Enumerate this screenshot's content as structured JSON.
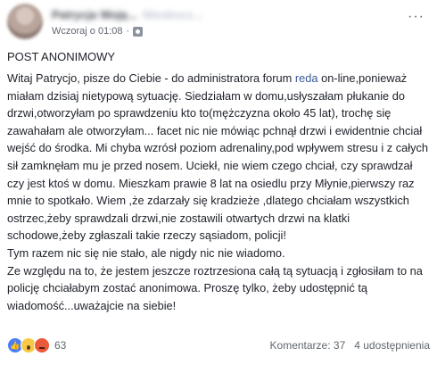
{
  "post": {
    "author_name": "Patrycja Woję...",
    "author_secondary": "Nieskocz...",
    "timestamp": "Wczoraj o 01:08",
    "privacy_icon": "public-globe-icon",
    "separator": "·",
    "more_label": "···",
    "title": "POST ANONIMOWY",
    "paragraph_1_before_link": "Witaj Patrycjo, pisze do Ciebie - do administratora forum ",
    "paragraph_1_link": "reda",
    "paragraph_1_after_link": " on-line,ponieważ miałam dzisiaj nietypową sytuację. Siedziałam w domu,usłyszałam płukanie do drzwi,otworzyłam po sprawdzeniu kto to(mężczyzna około 45 lat), trochę się zawahałam ale otworzyłam... facet nic nie mówiąc pchnął drzwi i ewidentnie chciał wejść do środka. Mi chyba wzrósł poziom adrenaliny,pod wpływem stresu i z całych sił zamknęłam mu je przed nosem. Uciekł, nie wiem czego chciał, czy sprawdzał czy jest ktoś w domu. Mieszkam prawie 8 lat na osiedlu przy Młynie,pierwszy raz mnie to spotkało. Wiem ,że zdarzały się kradzieże ,dlatego chciałam wszystkich ostrzec,żeby sprawdzali drzwi,nie zostawili otwartych drzwi na klatki schodowe,żeby zgłaszali takie rzeczy sąsiadom, policji!",
    "paragraph_2": "Tym razem nic się nie stało, ale nigdy nic nie wiadomo.",
    "paragraph_3": "Ze względu na to, że jestem jeszcze roztrzesiona całą tą sytuacją i zgłosiłam to na policję chciałabym zostać anonimowa. Proszę tylko, żeby udostępnić tą wiadomość...uważajcie na siebie!"
  },
  "footer": {
    "reaction_icons": [
      "like-icon",
      "wow-icon",
      "angry-icon"
    ],
    "reaction_count": "63",
    "comments": "Komentarze: 37",
    "shares": "4 udostępnienia"
  },
  "colors": {
    "link": "#385898",
    "text": "#1d2129",
    "meta": "#616770",
    "like": "#4a7ef2",
    "wow": "#f7c948",
    "angry": "#e9593a"
  }
}
